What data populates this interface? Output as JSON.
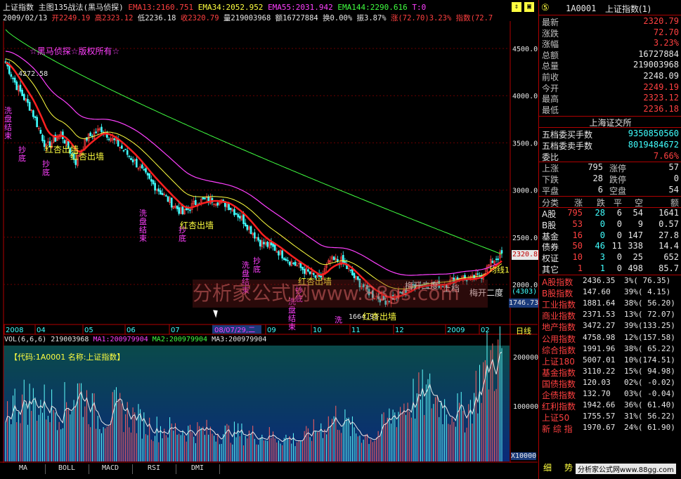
{
  "header": {
    "index_name": "上证指数",
    "indicator": "主图135战法",
    "indicator_sub": "(黑马侦探)",
    "ema13": "EMA13:2160.751",
    "ema34": "EMA34:2052.952",
    "ema55": "EMA55:2031.942",
    "ema144": "EMA144:2290.616",
    "t": "T:0",
    "date": "2009/02/13",
    "open": "开2249.19",
    "high": "高2323.12",
    "low": "低2236.18",
    "close": "收2320.79",
    "volume": "量219003968",
    "amount": "额16727884",
    "turnover": "换0.00%",
    "amplitude": "振3.87%",
    "change": "涨(72.70)3.23%",
    "tail": "指数(72.7"
  },
  "watermark": "☆黑马侦探☆版权所有☆",
  "watermark_big": "分析家公式网www.88gs.com",
  "annotations": {
    "peak_label": "4272.58",
    "wash_end": "洗盘结束",
    "bottom_buy": "抄底",
    "red_apricot": "红杏出墙",
    "plum_bloom": "梅开二度",
    "top_bar": "上档",
    "up_line": "均线1",
    "low_label": "1664.93"
  },
  "price_axis": {
    "ticks": [
      "4500.00",
      "4000.00",
      "3500.00",
      "3000.00",
      "2500.00",
      "2000.00"
    ],
    "current": "2320.8",
    "box1": "(4303)",
    "box2": "1746.73"
  },
  "time_axis": {
    "labels": [
      "2008",
      "04",
      "05",
      "06",
      "07",
      "08/07/29,二",
      "09",
      "10",
      "11",
      "12",
      "2009",
      "02"
    ],
    "period": "日线"
  },
  "volume_header": {
    "title": "VOL(6,6,6)",
    "vol": "219003968",
    "ma1": "MA1:200979904",
    "ma2": "MA2:200979904",
    "ma3": "MA3:200979904",
    "code_box": "【代码:1A0001  名称:上证指数】"
  },
  "volume_axis": {
    "ticks": [
      "200000",
      "100000"
    ],
    "unit": "X10000"
  },
  "tabs": [
    "MA",
    "BOLL",
    "MACD",
    "RSI",
    "DMI"
  ],
  "right_panel": {
    "num": "⑤",
    "code": "1A0001",
    "name": "上证指数(1)",
    "quote": [
      {
        "label": "最新",
        "value": "2320.79",
        "color": "#ff4040"
      },
      {
        "label": "涨跌",
        "value": "72.70",
        "color": "#ff4040"
      },
      {
        "label": "涨幅",
        "value": "3.23%",
        "color": "#ff4040"
      },
      {
        "label": "总额",
        "value": "16727884",
        "color": "#e8e8e8"
      },
      {
        "label": "总量",
        "value": "219003968",
        "color": "#e8e8e8"
      },
      {
        "label": "前收",
        "value": "2248.09",
        "color": "#e8e8e8"
      },
      {
        "label": "今开",
        "value": "2249.19",
        "color": "#ff4040"
      },
      {
        "label": "最高",
        "value": "2323.12",
        "color": "#ff4040"
      },
      {
        "label": "最低",
        "value": "2236.18",
        "color": "#ff4040"
      }
    ],
    "exchange": "上海证交所",
    "depth": [
      {
        "label": "五档委买手数",
        "value": "9350850560",
        "color": "#40ffff"
      },
      {
        "label": "五档委卖手数",
        "value": "8019484672",
        "color": "#40ffff"
      },
      {
        "label": "委比",
        "value": "7.66%",
        "color": "#ff4040"
      }
    ],
    "breadth": [
      {
        "l1": "上涨",
        "v1": "795",
        "l2": "涨停",
        "v2": "57"
      },
      {
        "l1": "下跌",
        "v1": "28",
        "l2": "跌停",
        "v2": "0"
      },
      {
        "l1": "平盘",
        "v1": "6",
        "l2": "空盘",
        "v2": "54"
      }
    ],
    "table_headers": [
      "分类",
      "涨",
      "跌",
      "平",
      "空",
      "额"
    ],
    "table_rows": [
      [
        "A股",
        "795",
        "28",
        "6",
        "54",
        "1641"
      ],
      [
        "B股",
        "53",
        "0",
        "0",
        "9",
        "0.57"
      ],
      [
        "基金",
        "16",
        "0",
        "0",
        "147",
        "27.8"
      ],
      [
        "债券",
        "50",
        "46",
        "11",
        "338",
        "14.4"
      ],
      [
        "权证",
        "10",
        "3",
        "0",
        "25",
        "652"
      ],
      [
        "其它",
        "1",
        "1",
        "0",
        "498",
        "85.7"
      ]
    ],
    "indices": [
      {
        "name": "A股指数",
        "value": "2436.35",
        "chg": "3%( 76.35)"
      },
      {
        "name": "B股指数",
        "value": "147.60",
        "chg": "39%( 4.15)"
      },
      {
        "name": "工业指数",
        "value": "1881.64",
        "chg": "38%( 56.20)"
      },
      {
        "name": "商业指数",
        "value": "2371.53",
        "chg": "13%( 72.07)"
      },
      {
        "name": "地产指数",
        "value": "3472.27",
        "chg": "39%(133.25)"
      },
      {
        "name": "公用指数",
        "value": "4758.98",
        "chg": "12%(157.58)"
      },
      {
        "name": "综合指数",
        "value": "1991.96",
        "chg": "38%( 65.22)"
      },
      {
        "name": "上证180",
        "value": "5007.01",
        "chg": "10%(174.51)"
      },
      {
        "name": "基金指数",
        "value": "3110.22",
        "chg": "15%( 94.98)"
      },
      {
        "name": "国债指数",
        "value": "120.03",
        "chg": "02%( -0.02)"
      },
      {
        "name": "企债指数",
        "value": "132.70",
        "chg": "03%( -0.04)"
      },
      {
        "name": "红利指数",
        "value": "1942.66",
        "chg": "36%( 61.40)"
      },
      {
        "name": "上证50",
        "value": "1755.57",
        "chg": "31%( 56.22)"
      },
      {
        "name": "新 综 指",
        "value": "1970.67",
        "chg": "24%( 61.90)"
      }
    ],
    "bottom_tabs": [
      "细",
      "势"
    ],
    "footer": "分析家公式网www.88gg.com"
  },
  "colors": {
    "up": "#ff4040",
    "down": "#40ffff",
    "ema13": "#ff2020",
    "ema34": "#ffff40",
    "ema55": "#ff40ff",
    "ema144": "#40ff40",
    "grid": "#8b0000"
  }
}
